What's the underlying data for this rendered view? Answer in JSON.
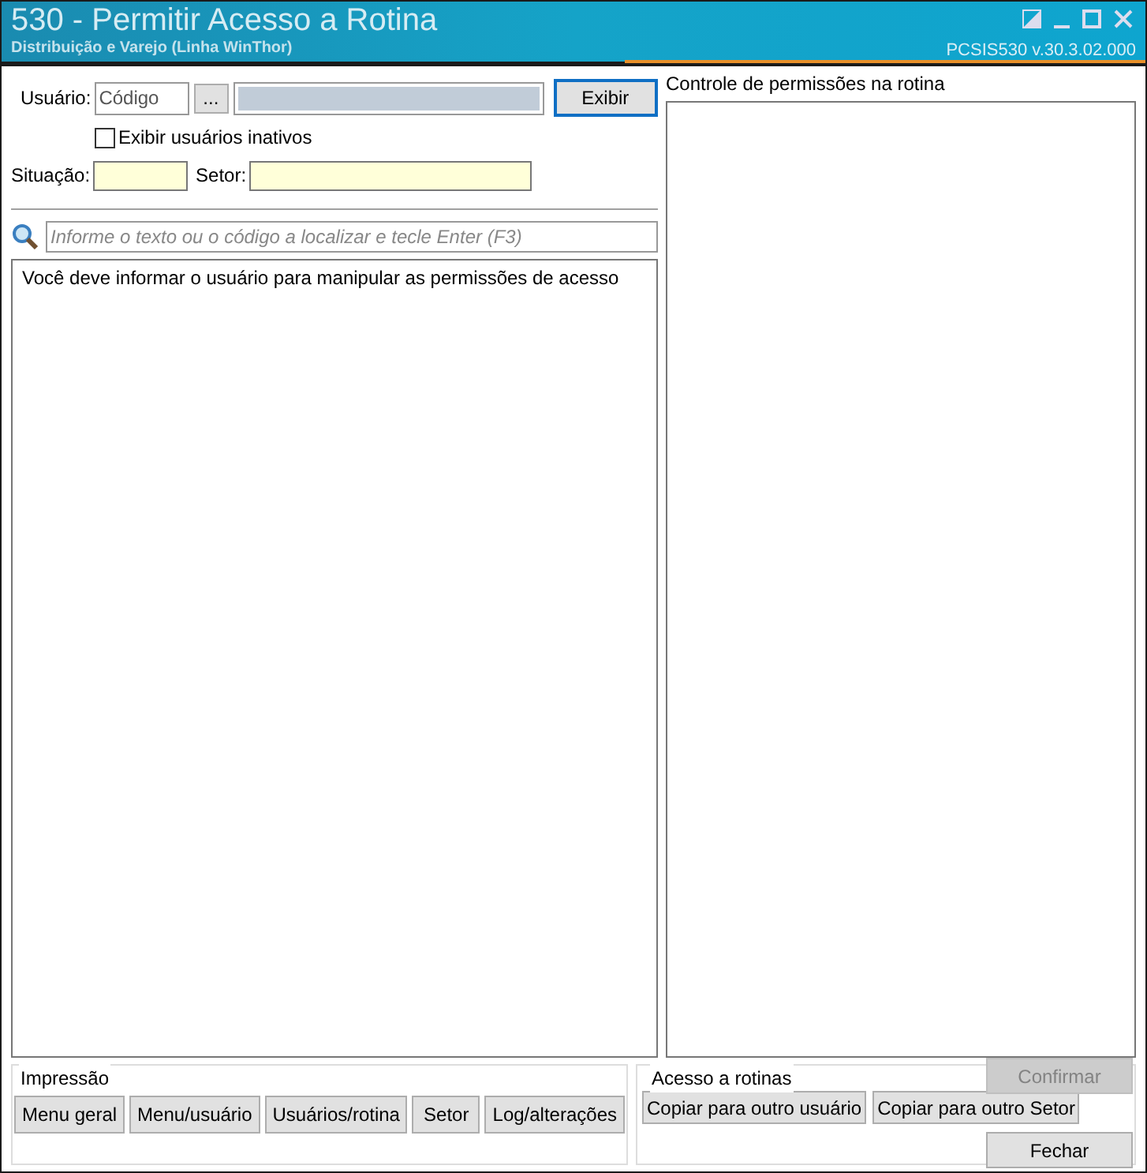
{
  "window": {
    "title": "530 - Permitir Acesso a Rotina",
    "subtitle": "Distribuição e Varejo (Linha WinThor)",
    "version": "PCSIS530  v.30.3.02.000"
  },
  "filters": {
    "user_label": "Usuário:",
    "user_code": {
      "placeholder": "Código"
    },
    "browse_button": "...",
    "show_button": "Exibir",
    "inactive": {
      "label": "Exibir usuários inativos",
      "checked": false
    },
    "situation_label": "Situação:",
    "sector_label": "Setor:"
  },
  "search": {
    "placeholder": "Informe o texto ou o código a localizar e tecle Enter (F3)"
  },
  "message": "Você deve informar o usuário para manipular as permissões de acesso",
  "permissions": {
    "title": "Controle de permissões na rotina"
  },
  "print_group": {
    "title": "Impressão",
    "buttons": [
      "Menu geral",
      "Menu/usuário",
      "Usuários/rotina",
      "Setor",
      "Log/alterações"
    ]
  },
  "access_group": {
    "title": "Acesso a rotinas",
    "buttons": [
      "Copiar para outro usuário",
      "Copiar para outro Setor"
    ]
  },
  "actions": [
    {
      "label": "Confirmar",
      "disabled": true
    },
    {
      "label": "Fechar",
      "disabled": false
    }
  ]
}
